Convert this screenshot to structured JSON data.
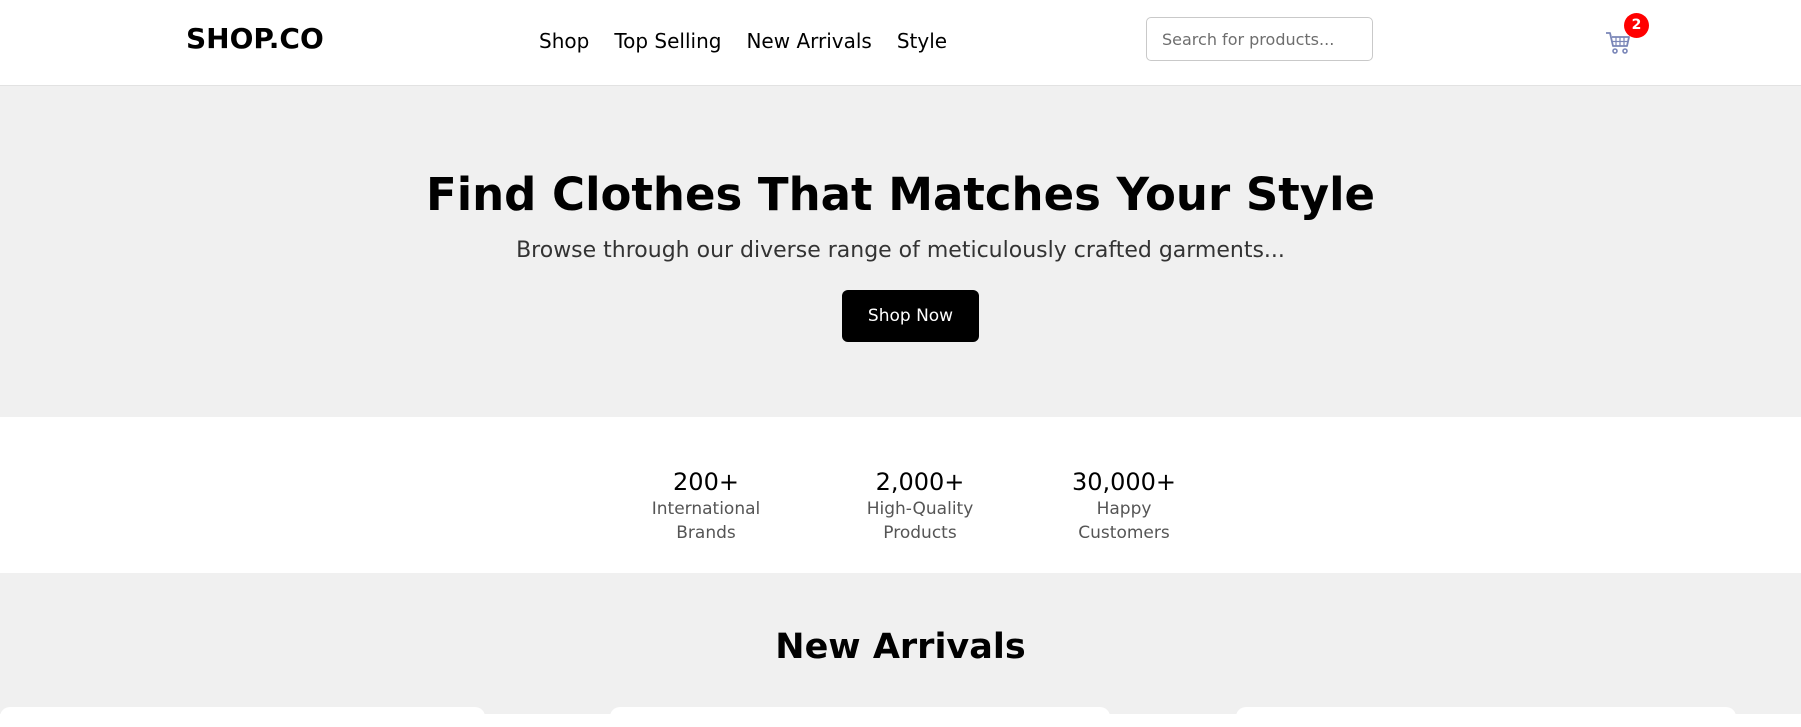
{
  "header": {
    "logo": "SHOP.CO",
    "nav": [
      "Shop",
      "Top Selling",
      "New Arrivals",
      "Style"
    ],
    "search_placeholder": "Search for products...",
    "cart_icon": "cart-icon",
    "cart_count": "2"
  },
  "hero": {
    "title": "Find Clothes That Matches Your Style",
    "subtitle": "Browse through our diverse range of meticulously crafted garments...",
    "cta": "Shop Now"
  },
  "stats": [
    {
      "value": "200+",
      "label": "International Brands"
    },
    {
      "value": "2,000+",
      "label": "High-Quality Products"
    },
    {
      "value": "30,000+",
      "label": "Happy Customers"
    }
  ],
  "arrivals": {
    "title": "New Arrivals"
  },
  "colors": {
    "accent": "#000000",
    "badge": "#ff0000",
    "section_bg": "#f0f0f0"
  }
}
